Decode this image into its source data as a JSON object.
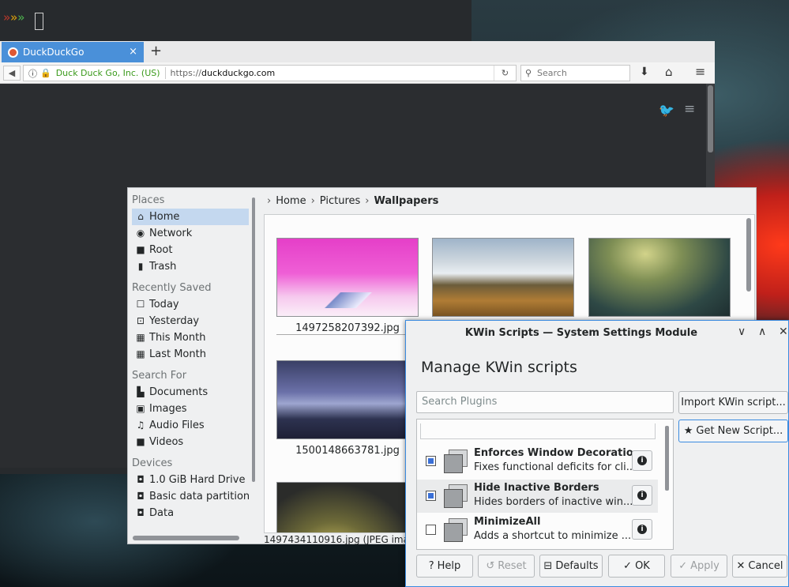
{
  "terminal": {
    "prompt": "»»»"
  },
  "browser": {
    "tab_title": "DuckDuckGo",
    "tab_close": "×",
    "new_tab": "+",
    "identity": "Duck Duck Go, Inc. (US)",
    "url_proto": "https://",
    "url_domain": "duckduckgo.com",
    "search_placeholder": "Search"
  },
  "files": {
    "places_header": "Places",
    "places": [
      {
        "label": "Home",
        "icon": "home-icon"
      },
      {
        "label": "Network",
        "icon": "network-icon"
      },
      {
        "label": "Root",
        "icon": "folder-icon"
      },
      {
        "label": "Trash",
        "icon": "trash-icon"
      }
    ],
    "recent_header": "Recently Saved",
    "recent": [
      {
        "label": "Today"
      },
      {
        "label": "Yesterday"
      },
      {
        "label": "This Month"
      },
      {
        "label": "Last Month"
      }
    ],
    "search_header": "Search For",
    "search": [
      {
        "label": "Documents"
      },
      {
        "label": "Images"
      },
      {
        "label": "Audio Files"
      },
      {
        "label": "Videos"
      }
    ],
    "devices_header": "Devices",
    "devices": [
      {
        "label": "1.0 GiB Hard Drive"
      },
      {
        "label": "Basic data partition"
      },
      {
        "label": "Data"
      }
    ],
    "breadcrumb": [
      "Home",
      "Pictures",
      "Wallpapers"
    ],
    "thumbs": [
      {
        "name": "1497258207392.jpg"
      },
      {
        "name": ""
      },
      {
        "name": ""
      },
      {
        "name": "1500148663781.jpg"
      },
      {
        "name": ""
      }
    ],
    "status": "1497434110916.jpg (JPEG ima"
  },
  "kwin": {
    "title": "KWin Scripts — System Settings Module",
    "heading": "Manage KWin scripts",
    "search_placeholder": "Search Plugins",
    "import_label": "Import KWin script...",
    "get_new_label": "Get New Script...",
    "scripts": [
      {
        "name": "Enforces Window Decoratio...",
        "desc": "Fixes functional deficits for cli...",
        "checked": true
      },
      {
        "name": "Hide Inactive Borders",
        "desc": "Hides borders of inactive win...",
        "checked": true
      },
      {
        "name": "MinimizeAll",
        "desc": "Adds a shortcut to minimize ...",
        "checked": false
      }
    ],
    "buttons": {
      "help": "Help",
      "reset": "Reset",
      "defaults": "Defaults",
      "ok": "OK",
      "apply": "Apply",
      "cancel": "Cancel"
    }
  }
}
